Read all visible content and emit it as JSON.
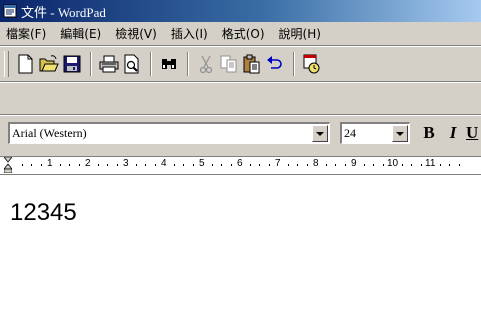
{
  "window": {
    "title": "文件 - WordPad",
    "icon": "wordpad-doc-icon"
  },
  "menu": {
    "items": [
      {
        "label": "檔案(F)"
      },
      {
        "label": "編輯(E)"
      },
      {
        "label": "檢視(V)"
      },
      {
        "label": "插入(I)"
      },
      {
        "label": "格式(O)"
      },
      {
        "label": "說明(H)"
      }
    ]
  },
  "toolbar": {
    "buttons": [
      {
        "name": "new-document-icon"
      },
      {
        "name": "open-folder-icon"
      },
      {
        "name": "save-disk-icon"
      },
      {
        "name": "print-icon"
      },
      {
        "name": "print-preview-icon"
      },
      {
        "name": "find-binoculars-icon"
      },
      {
        "name": "cut-scissors-icon"
      },
      {
        "name": "copy-icon"
      },
      {
        "name": "paste-clipboard-icon"
      },
      {
        "name": "undo-icon"
      },
      {
        "name": "insert-date-time-icon"
      }
    ]
  },
  "format": {
    "font_name": "Arial (Western)",
    "font_size": "24",
    "bold_label": "B",
    "italic_label": "I",
    "underline_label": "U"
  },
  "ruler": {
    "numbers": [
      "1",
      "2",
      "3",
      "4",
      "5",
      "6",
      "7",
      "8",
      "9",
      "10",
      "11"
    ]
  },
  "document": {
    "text": "12345"
  },
  "colors": {
    "titlebar_start": "#0a246a",
    "titlebar_end": "#a6caf0",
    "chrome": "#d4d0c8"
  }
}
